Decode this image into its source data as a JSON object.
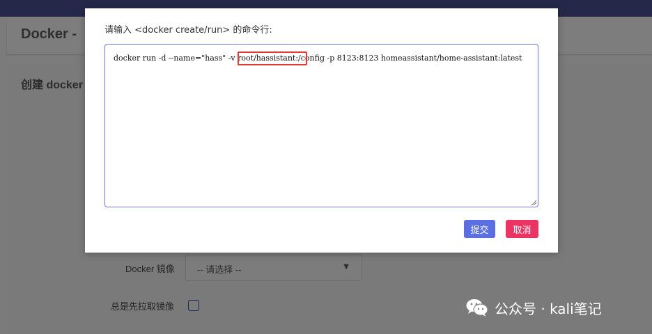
{
  "page": {
    "title": "Docker -",
    "section_title": "创建 docker",
    "form": {
      "image_label": "Docker 镜像",
      "image_select_value": "-- 请选择 --",
      "pull_label": "总是先拉取镜像"
    }
  },
  "modal": {
    "title": "请输入 <docker create/run> 的命令行:",
    "command": "docker run -d --name=\"hass\" -v root/hassistant:/config -p 8123:8123 homeassistant/home-assistant:latest",
    "submit_label": "提交",
    "cancel_label": "取消"
  },
  "watermark": {
    "text": "公众号 · kali笔记"
  },
  "colors": {
    "accent": "#5b6fe0",
    "danger": "#ec3462",
    "highlight": "#e53935",
    "nav": "#252848"
  }
}
